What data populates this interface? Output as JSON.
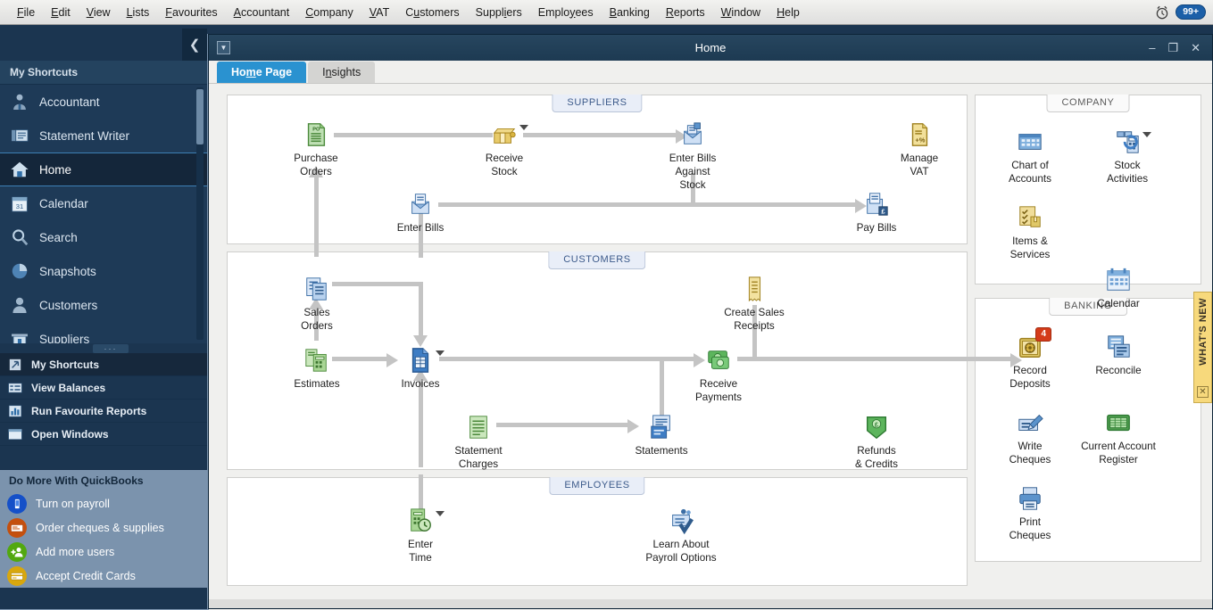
{
  "menubar": {
    "items": [
      {
        "label": "File",
        "accel": "F"
      },
      {
        "label": "Edit",
        "accel": "E"
      },
      {
        "label": "View",
        "accel": "V"
      },
      {
        "label": "Lists",
        "accel": "L"
      },
      {
        "label": "Favourites",
        "accel": "F"
      },
      {
        "label": "Accountant",
        "accel": "A"
      },
      {
        "label": "Company",
        "accel": "C"
      },
      {
        "label": "VAT",
        "accel": "V"
      },
      {
        "label": "Customers",
        "accel": "u"
      },
      {
        "label": "Suppliers",
        "accel": "i"
      },
      {
        "label": "Employees",
        "accel": "y"
      },
      {
        "label": "Banking",
        "accel": "B"
      },
      {
        "label": "Reports",
        "accel": "R"
      },
      {
        "label": "Window",
        "accel": "W"
      },
      {
        "label": "Help",
        "accel": "H"
      }
    ],
    "alarm_icon": "alarm-clock-icon",
    "notification_count": "99+"
  },
  "sidebar": {
    "collapse_icon": "chevron-left-icon",
    "header": "My Shortcuts",
    "items": [
      {
        "label": "Accountant",
        "icon": "accountant-person-icon",
        "active": false
      },
      {
        "label": "Statement Writer",
        "icon": "statement-writer-icon",
        "active": false
      },
      {
        "label": "Home",
        "icon": "home-icon",
        "active": true
      },
      {
        "label": "Calendar",
        "icon": "calendar-31-icon",
        "active": false
      },
      {
        "label": "Search",
        "icon": "magnifier-icon",
        "active": false
      },
      {
        "label": "Snapshots",
        "icon": "pie-chart-icon",
        "active": false
      },
      {
        "label": "Customers",
        "icon": "person-icon",
        "active": false
      },
      {
        "label": "Suppliers",
        "icon": "suppliers-icon",
        "active": false
      }
    ],
    "grip": "···",
    "sections": [
      {
        "label": "My Shortcuts",
        "icon": "shortcuts-icon",
        "selected": true
      },
      {
        "label": "View Balances",
        "icon": "balances-icon",
        "selected": false
      },
      {
        "label": "Run Favourite Reports",
        "icon": "bar-chart-icon",
        "selected": false
      },
      {
        "label": "Open Windows",
        "icon": "window-icon",
        "selected": false
      }
    ],
    "more_header": "Do More With QuickBooks",
    "more_items": [
      {
        "label": "Turn on payroll",
        "icon": "mobile-phone-icon",
        "color": "#1550c8"
      },
      {
        "label": "Order cheques & supplies",
        "icon": "cheque-book-icon",
        "color": "#c4500e"
      },
      {
        "label": "Add more users",
        "icon": "add-user-icon",
        "color": "#52a80f"
      },
      {
        "label": "Accept Credit Cards",
        "icon": "credit-card-icon",
        "color": "#d8a70d"
      }
    ]
  },
  "window": {
    "menu_icon": "window-menu-icon",
    "title": "Home",
    "minimize": "–",
    "maximize": "❐",
    "close": "✕",
    "tabs": [
      {
        "label": "Home Page",
        "accel": "m",
        "active": true
      },
      {
        "label": "Insights",
        "accel": "n",
        "active": false
      }
    ]
  },
  "flow": {
    "suppliers": {
      "title": "SUPPLIERS",
      "nodes": [
        {
          "name": "purchase-orders",
          "label": "Purchase\nOrders",
          "icon": "po-document-icon",
          "caret": false,
          "badge": null
        },
        {
          "name": "receive-stock",
          "label": "Receive\nStock",
          "icon": "box-package-icon",
          "caret": true,
          "badge": null
        },
        {
          "name": "enter-bills-against-stock",
          "label": "Enter Bills\nAgainst\nStock",
          "icon": "bill-stock-icon",
          "caret": false,
          "badge": null
        },
        {
          "name": "manage-vat",
          "label": "Manage\nVAT",
          "icon": "vat-document-icon",
          "caret": false,
          "badge": null
        },
        {
          "name": "enter-bills",
          "label": "Enter Bills",
          "icon": "bill-icon",
          "caret": false,
          "badge": null
        },
        {
          "name": "pay-bills",
          "label": "Pay Bills",
          "icon": "pay-bills-icon",
          "caret": false,
          "badge": null
        }
      ]
    },
    "customers": {
      "title": "CUSTOMERS",
      "nodes": [
        {
          "name": "sales-orders",
          "label": "Sales\nOrders",
          "icon": "sales-orders-icon",
          "caret": false,
          "badge": null
        },
        {
          "name": "create-sales-receipts",
          "label": "Create Sales\nReceipts",
          "icon": "receipt-icon",
          "caret": false,
          "badge": null
        },
        {
          "name": "estimates",
          "label": "Estimates",
          "icon": "estimates-icon",
          "caret": false,
          "badge": null
        },
        {
          "name": "invoices",
          "label": "Invoices",
          "icon": "invoice-icon",
          "caret": true,
          "badge": null
        },
        {
          "name": "receive-payments",
          "label": "Receive\nPayments",
          "icon": "money-icon",
          "caret": false,
          "badge": null
        },
        {
          "name": "statement-charges",
          "label": "Statement\nCharges",
          "icon": "statement-charges-icon",
          "caret": false,
          "badge": null
        },
        {
          "name": "statements",
          "label": "Statements",
          "icon": "statements-icon",
          "caret": false,
          "badge": null
        },
        {
          "name": "refunds-and-credits",
          "label": "Refunds\n& Credits",
          "icon": "refund-icon",
          "caret": false,
          "badge": null
        }
      ]
    },
    "employees": {
      "title": "EMPLOYEES",
      "nodes": [
        {
          "name": "enter-time",
          "label": "Enter\nTime",
          "icon": "timesheet-icon",
          "caret": true,
          "badge": null
        },
        {
          "name": "learn-about-payroll-options",
          "label": "Learn About\nPayroll Options",
          "icon": "payroll-icon",
          "caret": false,
          "badge": null
        }
      ]
    }
  },
  "company": {
    "title": "COMPANY",
    "nodes": [
      {
        "name": "chart-of-accounts",
        "label": "Chart of\nAccounts",
        "icon": "chart-of-accounts-icon",
        "caret": false,
        "badge": null
      },
      {
        "name": "stock-activities",
        "label": "Stock\nActivities",
        "icon": "stock-activities-icon",
        "caret": true,
        "badge": null
      },
      {
        "name": "items-and-services",
        "label": "Items &\nServices",
        "icon": "items-services-icon",
        "caret": false,
        "badge": null
      },
      {
        "name": "calendar",
        "label": "Calendar",
        "icon": "calendar-icon",
        "caret": false,
        "badge": null
      }
    ]
  },
  "banking": {
    "title": "BANKING",
    "nodes": [
      {
        "name": "record-deposits",
        "label": "Record\nDeposits",
        "icon": "safe-deposit-icon",
        "caret": false,
        "badge": "4"
      },
      {
        "name": "reconcile",
        "label": "Reconcile",
        "icon": "reconcile-icon",
        "caret": false,
        "badge": null
      },
      {
        "name": "write-cheques",
        "label": "Write\nCheques",
        "icon": "write-cheque-icon",
        "caret": false,
        "badge": null
      },
      {
        "name": "current-account-register",
        "label": "Current Account\nRegister",
        "icon": "register-icon",
        "caret": false,
        "badge": null
      },
      {
        "name": "print-cheques",
        "label": "Print\nCheques",
        "icon": "printer-icon",
        "caret": false,
        "badge": null
      }
    ]
  },
  "whats_new": {
    "label": "WHAT'S NEW",
    "close": "✕"
  },
  "colors": {
    "accent": "#2a92d0",
    "sidebar_bg": "#1b3550",
    "badge_red": "#d43b1a",
    "whats_new": "#f7d97c"
  }
}
